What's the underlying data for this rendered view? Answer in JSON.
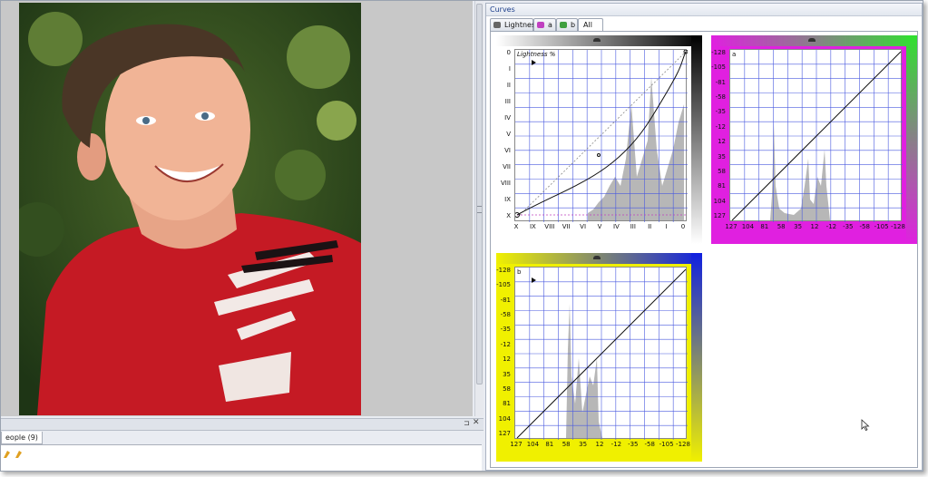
{
  "curves": {
    "title": "Curves",
    "tabs": [
      {
        "label": "Lightness",
        "icon": "lightness-icon",
        "color": "#555555"
      },
      {
        "label": "a",
        "icon": "a-channel-icon",
        "color": "#c040c0"
      },
      {
        "label": "b",
        "icon": "b-channel-icon",
        "color": "#40a040"
      },
      {
        "label": "All",
        "icon": "",
        "color": ""
      }
    ],
    "active_tab": "All",
    "lightness": {
      "label": "Lightness %",
      "ylabels": [
        "0",
        "I",
        "II",
        "III",
        "IV",
        "V",
        "VI",
        "VII",
        "VIII",
        "IX",
        "X"
      ],
      "xlabels": [
        "X",
        "IX",
        "VIII",
        "VII",
        "VI",
        "V",
        "IV",
        "III",
        "II",
        "I",
        "0"
      ]
    },
    "a": {
      "label": "a",
      "ylabels": [
        "-128",
        "-105",
        "-81",
        "-58",
        "-35",
        "-12",
        "12",
        "35",
        "58",
        "81",
        "104",
        "127"
      ],
      "xlabels": [
        "127",
        "104",
        "81",
        "58",
        "35",
        "12",
        "-12",
        "-35",
        "-58",
        "-105",
        "-128"
      ]
    },
    "b": {
      "label": "b",
      "ylabels": [
        "-128",
        "-105",
        "-81",
        "-58",
        "-35",
        "-12",
        "12",
        "35",
        "58",
        "81",
        "104",
        "127"
      ],
      "xlabels": [
        "127",
        "104",
        "81",
        "58",
        "35",
        "12",
        "-12",
        "-35",
        "-58",
        "-105",
        "-128"
      ]
    }
  },
  "bottom_panel": {
    "tab_label": "eople (9)",
    "pin": "⊐",
    "close": "✕"
  },
  "colors": {
    "grid": "#4a5adf",
    "gradient_a_left": "#e020e0",
    "gradient_a_right": "#30e030",
    "gradient_b_left": "#f0f000",
    "gradient_b_right": "#1020e0",
    "title_text": "#1b3d8a"
  }
}
